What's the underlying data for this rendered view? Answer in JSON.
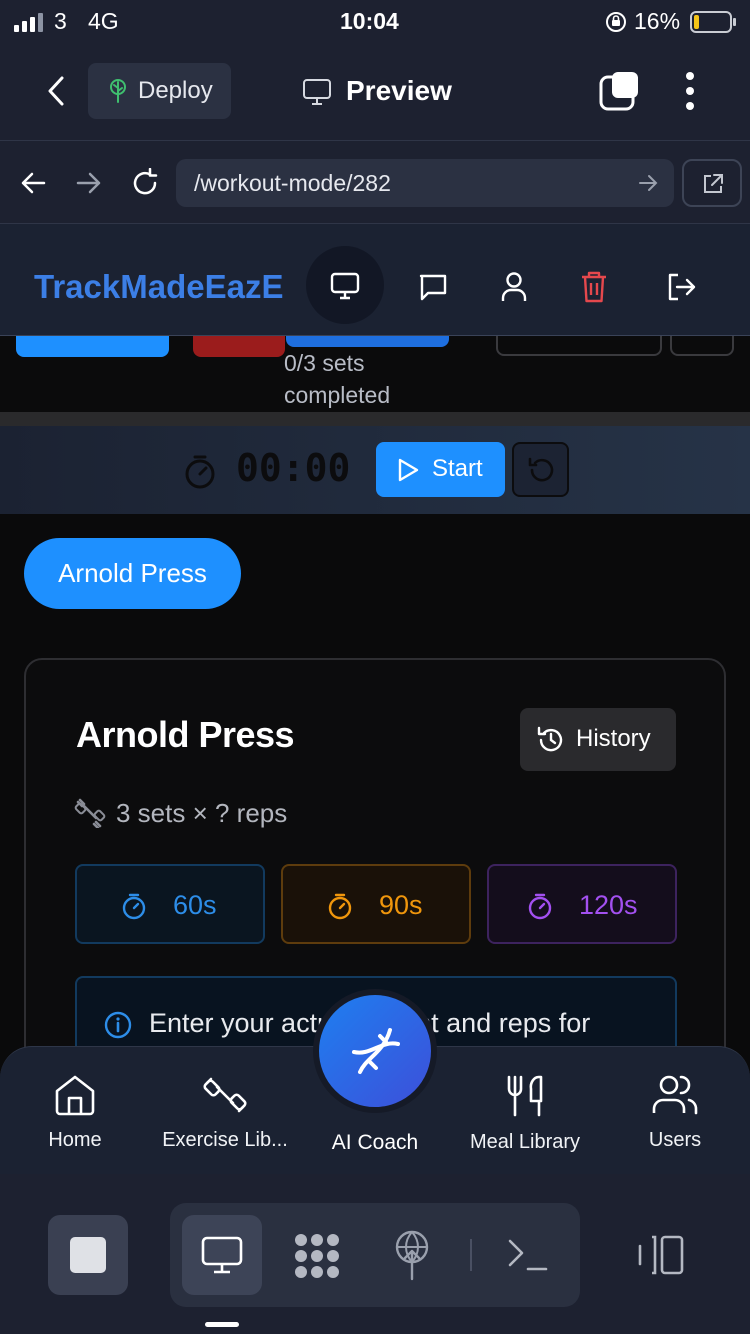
{
  "status": {
    "carrier": "3",
    "network": "4G",
    "time": "10:04",
    "battery": "16%"
  },
  "replit": {
    "deploy_label": "Deploy",
    "preview_label": "Preview",
    "url": "/workout-mode/282"
  },
  "app": {
    "brand": "TrackMadeEazE"
  },
  "partial": {
    "sets_completed": "0/3 sets",
    "completed_word": "completed"
  },
  "timer": {
    "display": "00:00",
    "start_label": "Start"
  },
  "exercise_chip": "Arnold Press",
  "card": {
    "title": "Arnold Press",
    "history_label": "History",
    "sets_info": "3 sets × ? reps",
    "rest_options": [
      {
        "label": "60s",
        "color": "#2d8de8"
      },
      {
        "label": "90s",
        "color": "#f0960c"
      },
      {
        "label": "120s",
        "color": "#a350f0"
      }
    ],
    "info_text": "Enter your actual weight and reps for"
  },
  "bottomnav": {
    "items": [
      {
        "label": "Home"
      },
      {
        "label": "Exercise Lib..."
      },
      {
        "label": "AI Coach"
      },
      {
        "label": "Meal Library"
      },
      {
        "label": "Users"
      }
    ]
  },
  "colors": {
    "accent": "#1e90ff",
    "danger": "#e5484d",
    "brand": "#3c7fe6"
  }
}
